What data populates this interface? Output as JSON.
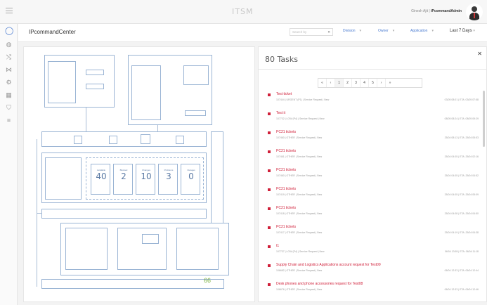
{
  "app": {
    "brand": "ITSM",
    "nav_user": "Ginesh Ajit",
    "username": "iPcommandAdmin",
    "divider": "|"
  },
  "nav": {
    "icons": [
      "circle-user-icon",
      "globe-icon",
      "route-icon",
      "topology-icon",
      "gear-icon",
      "calendar-icon",
      "map-icon",
      "list-icon"
    ]
  },
  "header": {
    "title": "IPcommandCenter",
    "search_placeholder": "Search by",
    "filters": [
      "Division",
      "Owner",
      "Application"
    ],
    "range": "Last 7 Days"
  },
  "diagram": {
    "counters": [
      {
        "value": "40",
        "caption": "Available"
      },
      {
        "value": "2",
        "caption": "Blocked"
      },
      {
        "value": "10",
        "caption": "Changes"
      },
      {
        "value": "3",
        "caption": "Problems"
      },
      {
        "value": "0",
        "caption": "Outages"
      }
    ],
    "bottom_count": "66"
  },
  "tasks": {
    "title": "80 Tasks",
    "pager": [
      "«",
      "‹",
      "1",
      "2",
      "3",
      "4",
      "5",
      "›",
      "»"
    ],
    "active_page": "1",
    "items": [
      {
        "title": "Test ticket",
        "meta": "107444 | URGENT (P1) | Service Request | New",
        "date": "03/05 08:01 | ETA: 03/05 07:58"
      },
      {
        "title": "Test it",
        "meta": "107732 | LOW (P4) | Service Request | New",
        "date": "08/05 08:24 | ETA: 08/05 09:29"
      },
      {
        "title": "PC21 tickets",
        "meta": "107460 | OTHER | Service Request | New",
        "date": "25/04 08:13 | ETA: 25/04 05:53"
      },
      {
        "title": "PC21 tickets",
        "meta": "107461 | OTHER | Service Request | New",
        "date": "25/04 04:05 | ETA: 25/04 02:16"
      },
      {
        "title": "PC21 tickets",
        "meta": "107460 | OTHER | Service Request | New",
        "date": "25/04 04:05 | ETA: 25/04 04:52"
      },
      {
        "title": "PC21 tickets",
        "meta": "107419 | OTHER | Service Request | New",
        "date": "25/04 04:05 | ETA: 25/04 05:09"
      },
      {
        "title": "PC21 tickets",
        "meta": "107418 | OTHER | Service Request | New",
        "date": "25/04 04:08 | ETA: 25/04 04:50"
      },
      {
        "title": "PC21 tickets",
        "meta": "107417 | OTHER | Service Request | New",
        "date": "25/04 04:19 | ETA: 25/04 04:38"
      },
      {
        "title": "t1",
        "meta": "107737 | LOW (P4) | Service Request | New",
        "date": "06/04 13:55 | ETA: 06/04 11:18"
      },
      {
        "title": "Supply Chain and Logistics Applications account request for Test09",
        "meta": "106682 | OTHER | Service Request | New",
        "date": "06/04 12:33 | ETA: 06/04 12:44"
      },
      {
        "title": "Desk phones and phone accessories request for Test08",
        "meta": "106676 | OTHER | Service Request | New",
        "date": "06/04 12:33 | ETA: 06/04 12:46"
      }
    ]
  },
  "colors": {
    "accent": "#4a7bd0",
    "task_red": "#d0203a",
    "diagram_blue": "#9ab4d4",
    "count_green": "#7cb342"
  }
}
